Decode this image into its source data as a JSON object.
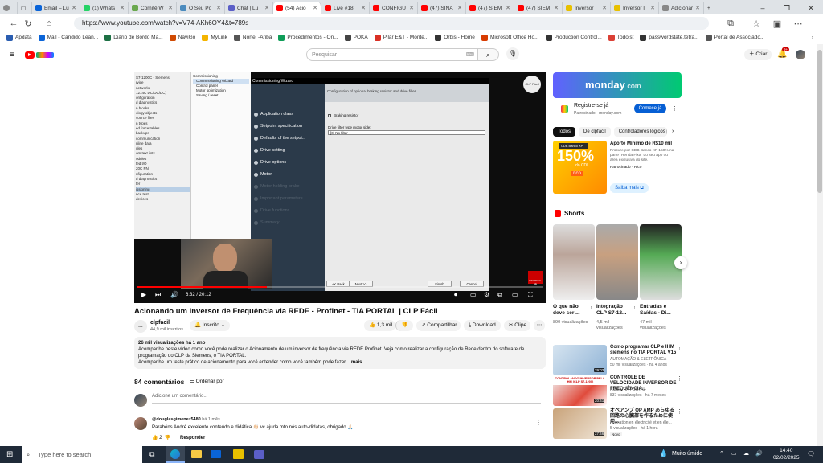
{
  "browser": {
    "tabs": [
      {
        "label": "Email – Lu",
        "color": "#0a64d8"
      },
      {
        "label": "(1) Whats",
        "color": "#25d366"
      },
      {
        "label": "Comitê W",
        "color": "#6aa84f"
      },
      {
        "label": "O Seu Po",
        "color": "#4b8bbe"
      },
      {
        "label": "Chat | Lu",
        "color": "#5b5fc7"
      },
      {
        "label": "(54) Acio",
        "color": "#ff0000"
      },
      {
        "label": "Live #18",
        "color": "#ff0000"
      },
      {
        "label": "CONFIGU",
        "color": "#ff0000"
      },
      {
        "label": "(47) SINA",
        "color": "#ff0000"
      },
      {
        "label": "(47) SIEM",
        "color": "#ff0000"
      },
      {
        "label": "(47) SIEM",
        "color": "#ff0000"
      },
      {
        "label": "Inversor",
        "color": "#e8c000"
      },
      {
        "label": "Inversor I",
        "color": "#e8c000"
      },
      {
        "label": "Adicionar",
        "color": "#888888"
      }
    ],
    "active_tab_index": 5,
    "url": "https://www.youtube.com/watch?v=V74-AKh6OY4&t=789s",
    "bookmarks": [
      {
        "label": "Apdata",
        "color": "#2a5db0"
      },
      {
        "label": "Mail - Candido Lean...",
        "color": "#0a64d8"
      },
      {
        "label": "Diário de Bordo Ma...",
        "color": "#1d7044"
      },
      {
        "label": "NaviGo",
        "color": "#d04a02"
      },
      {
        "label": "MyLink",
        "color": "#f4b400"
      },
      {
        "label": "Nortel -Ariba",
        "color": "#555555"
      },
      {
        "label": "Procedimentos - On...",
        "color": "#0f9d58"
      },
      {
        "label": "POKA",
        "color": "#444444"
      },
      {
        "label": "Pilar E&T - Monte...",
        "color": "#d93025"
      },
      {
        "label": "Orbis - Home",
        "color": "#333333"
      },
      {
        "label": "Microsoft Office Ho...",
        "color": "#d83b01"
      },
      {
        "label": "Production Control...",
        "color": "#333333"
      },
      {
        "label": "Todoist",
        "color": "#db4035"
      },
      {
        "label": "passwordstate.tetra...",
        "color": "#333333"
      },
      {
        "label": "Portal de Associado...",
        "color": "#555555"
      }
    ]
  },
  "youtube": {
    "search_placeholder": "Pesquisar",
    "create_label": "Criar",
    "notif_count": "9+"
  },
  "video": {
    "time": "6:32 / 20:12",
    "progress": 0.32,
    "tia_tree": [
      "S7-1200C - Siemens",
      "  rvice",
      "  networks",
      "  1214C DC/DC/DC]",
      "  onfiguration",
      "  d diagnostics",
      "  n blocks",
      "  ology objects",
      "  source files",
      "",
      "  n types",
      "  ed force tables",
      "  backups",
      "",
      "  communication",
      "  nline data",
      "  ules",
      "  om text lists",
      "  odules",
      "  ted I/O",
      "  20C PN]",
      "  nfiguration",
      "  d diagnostics",
      "  ter",
      "  issioning",
      "  nce test",
      "",
      "  devices"
    ],
    "tia_mid": [
      "Commissioning",
      "Commissioning Wizard",
      "Control panel",
      "Motor optimization",
      "Saving / reset"
    ],
    "wizard_title": "Commissioning Wizard",
    "wizard_steps": [
      "Application class",
      "Setpoint specification",
      "Defaults of the setpoi...",
      "Drive setting",
      "Drive options",
      "Motor",
      "Motor holding brake",
      "Important parameters",
      "Drive functions",
      "Summary"
    ],
    "wizard_dim_from": 6,
    "wizard_header": "Configuration of optional braking resistor and drive filter",
    "wizard_check": "Braking resistor",
    "wizard_filter_label": "Drive filter type motor side:",
    "wizard_filter_value": "[0] No filter",
    "wizard_buttons": [
      "<< Back",
      "Next >>",
      "Finish",
      "Cancel"
    ],
    "channel_watermark": "CLP Fácil",
    "subscribe_badge": "INSCREVA-SE"
  },
  "title": "Acionando um Inversor de Frequência via REDE - Profinet - TIA PORTAL | CLP Fácil",
  "channel": {
    "name": "clpfacil",
    "subs": "44,9 mil inscritos",
    "subscribed_label": "Inscrito"
  },
  "actions": {
    "likes": "1,3 mil",
    "share": "Compartilhar",
    "download": "Download",
    "clip": "Clipe"
  },
  "description": {
    "meta": "26 mil visualizações  há 1 ano",
    "line1": "Acompanhe neste vídeo como você pode realizar o Acionamento de um inversor de frequência via REDE Profinet. Veja como realizar a configuração de Rede dentro do software de programação do CLP da Siemens, o TIA PORTAL.",
    "line2": "Acompanhe um teste prático de acionamento para você entender como você também pode fazer",
    "more": "...mais"
  },
  "comments": {
    "count": "84 comentários",
    "sort": "Ordenar por",
    "add_placeholder": "Adicione um comentário...",
    "first": {
      "user": "@douglasgimenez5480",
      "time": "há 1 mês",
      "text": "Parabéns André excelente conteúdo e didática 👏🏻 vc ajuda mto nós auto-didatas, obrigado 🙏🏻",
      "likes": "2",
      "reply": "Responder"
    }
  },
  "sidebar": {
    "ad_brand": "monday",
    "ad_brand_suffix": ".com",
    "ad_cta_title": "Registre-se já",
    "ad_sponsored": "Patrocinado · monday.com",
    "ad_cta_button": "Comece já",
    "chips": [
      "Todos",
      "De clpfacil",
      "Controladores lógicos prog"
    ],
    "promo": {
      "title": "Aporte Mínimo de R$10 mil",
      "text": "Procure por CDB Banco XP 150% na parte \"Renda Fixa\" do seu app ou área exclusiva do site.",
      "sponsor": "Patrocinado · Rico",
      "button": "Saiba mais",
      "thumb_top": "CDB Banco XP",
      "thumb_big": "150%",
      "thumb_sub": "do CDI",
      "thumb_brand": "rico"
    },
    "shorts_label": "Shorts",
    "shorts": [
      {
        "title": "O que não deve ser ...",
        "views": "890 visualizações"
      },
      {
        "title": "Integração CLP S7-12...",
        "views": "4,5 mil visualizações"
      },
      {
        "title": "Entradas e Saídas - Di...",
        "views": "47 mil visualizações"
      }
    ],
    "recs": [
      {
        "title": "Como programar CLP e IHM siemens no TIA PORTAL V15",
        "channel": "AUTOMAÇÃO & ELETRÔNICA",
        "meta": "50 mil visualizações · há 4 anos",
        "duration": "29:03"
      },
      {
        "title": "CONTROLE DE VELOCIDADE INVERSOR DE FREQUÊNCIA...",
        "channel": "Kanpa TIA PORTAL",
        "meta": "837 visualizações · há 7 meses",
        "duration": "20:41",
        "thumb_text": "CONTROLANDO INVERSOR PELA IHM (CLP S7-1200)"
      },
      {
        "title": "オペアンプ OP AMP あらゆる回路の心臓部を作るために使用...",
        "channel": "Formation en électricité et en éle...",
        "meta": "5 visualizações · há 1 hora",
        "duration": "27:46",
        "badge": "Novo"
      }
    ]
  },
  "taskbar": {
    "search_placeholder": "Type here to search",
    "weather": "Muito úmido",
    "time": "14:40",
    "date": "02/02/2025"
  }
}
